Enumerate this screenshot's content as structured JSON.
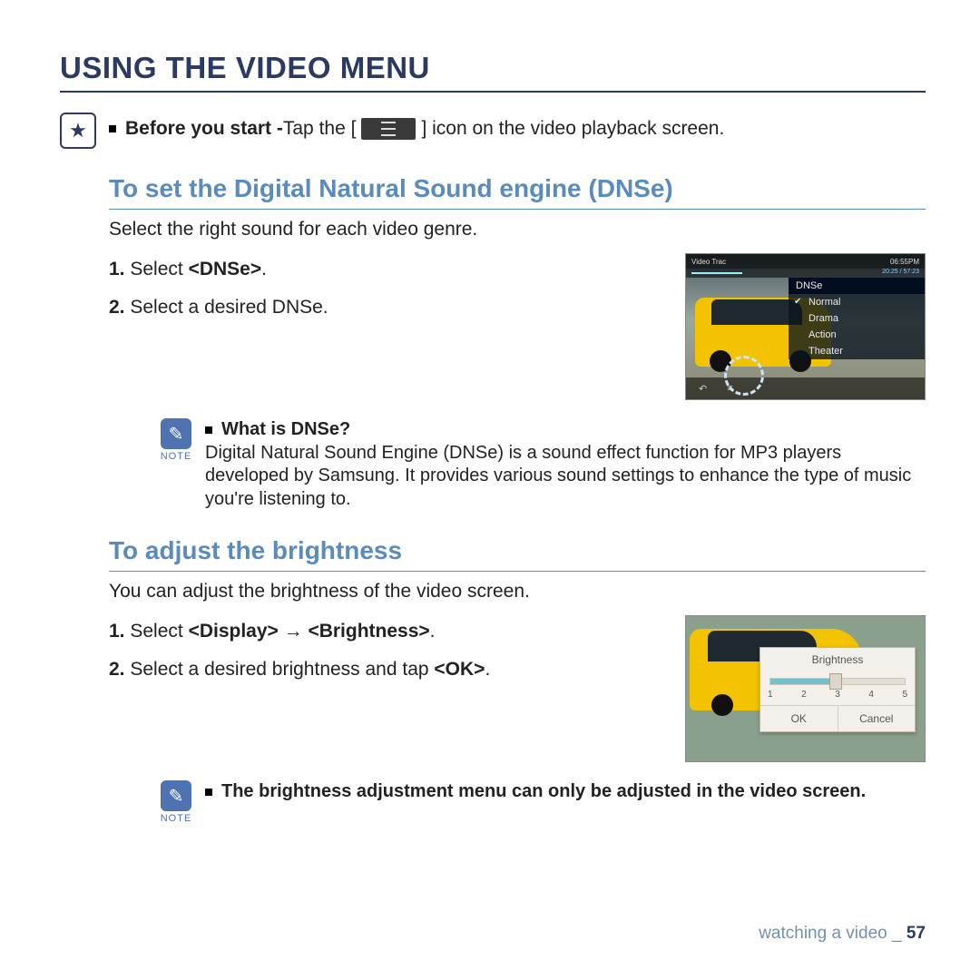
{
  "title": "USING THE VIDEO MENU",
  "start": {
    "prefix": "Before you start - ",
    "mid": "Tap the [",
    "suffix": "] icon on the video playback screen."
  },
  "dnse": {
    "heading": "To set the Digital Natural Sound engine (DNSe)",
    "intro": "Select the right sound for each video genre.",
    "step1_pre": "Select ",
    "step1_bold": "<DNSe>",
    "step1_post": ".",
    "step2": "Select a desired DNSe.",
    "note_title": "What is DNSe?",
    "note_body": "Digital Natural Sound Engine (DNSe) is a sound effect function for MP3 players developed by Samsung. It provides various sound settings to enhance the type of music you're listening to."
  },
  "screenshot1": {
    "topbar_left": "Video Trac",
    "topbar_right": "06:55PM",
    "progress_time": "20:25 / 57:23",
    "menu_header": "DNSe",
    "items": [
      "Normal",
      "Drama",
      "Action",
      "Theater"
    ],
    "selected_index": 0
  },
  "brightness": {
    "heading": "To adjust the brightness",
    "intro": "You can adjust the brightness of the video screen.",
    "step1_pre": "Select ",
    "step1_bold": "<Display> → <Brightness>",
    "step1_post": ".",
    "step2_pre": "Select a desired brightness and tap ",
    "step2_bold": "<OK>",
    "step2_post": ".",
    "note": "The brightness adjustment menu can only be adjusted in the video screen."
  },
  "screenshot2": {
    "title": "Brightness",
    "ticks": [
      "1",
      "2",
      "3",
      "4",
      "5"
    ],
    "ok": "OK",
    "cancel": "Cancel"
  },
  "footer": {
    "section": "watching a video _ ",
    "page": "57"
  },
  "note_label": "NOTE"
}
